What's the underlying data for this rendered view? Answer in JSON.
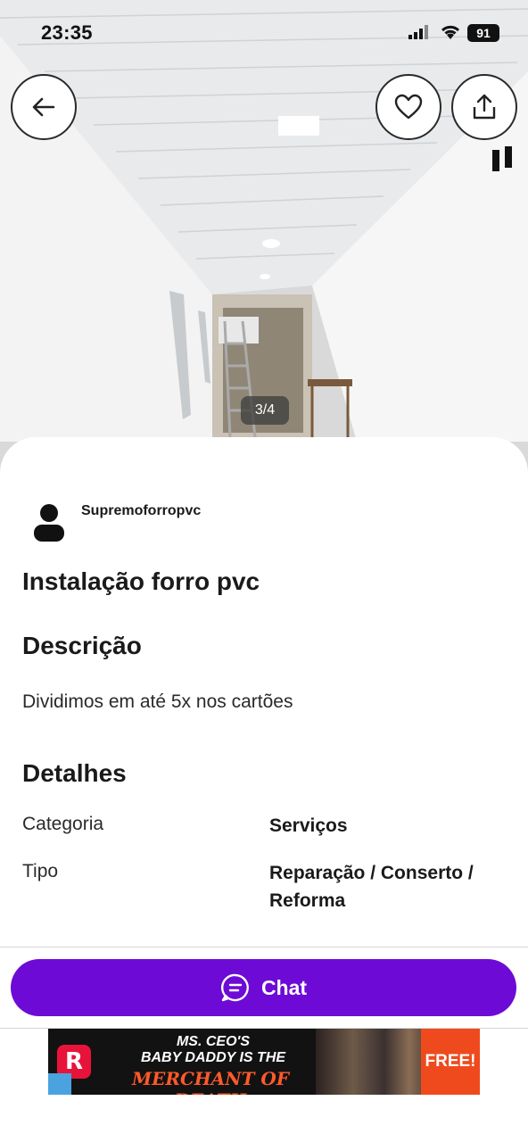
{
  "status_bar": {
    "time": "23:35",
    "battery": "91"
  },
  "photo": {
    "counter": "3/4"
  },
  "seller": {
    "name": "Supremoforropvc"
  },
  "listing": {
    "title": "Instalação forro pvc",
    "description_heading": "Descrição",
    "description": "Dividimos em até 5x nos cartões",
    "details_heading": "Detalhes",
    "details": [
      {
        "label": "Categoria",
        "value": "Serviços"
      },
      {
        "label": "Tipo",
        "value": "Reparação / Conserto / Reforma"
      }
    ]
  },
  "actions": {
    "chat_label": "Chat"
  },
  "ad": {
    "line1": "MS. CEO'S",
    "line2": "BABY DADDY IS THE",
    "line3": "MERCHANT OF DEATH",
    "cta": "FREE!",
    "logo_letter": "R"
  },
  "colors": {
    "accent": "#6e0ad6",
    "text": "#1a1a1a"
  },
  "icons": [
    "back-arrow-icon",
    "heart-icon",
    "share-icon",
    "user-icon",
    "chat-bubble-icon",
    "signal-icon",
    "wifi-icon"
  ]
}
